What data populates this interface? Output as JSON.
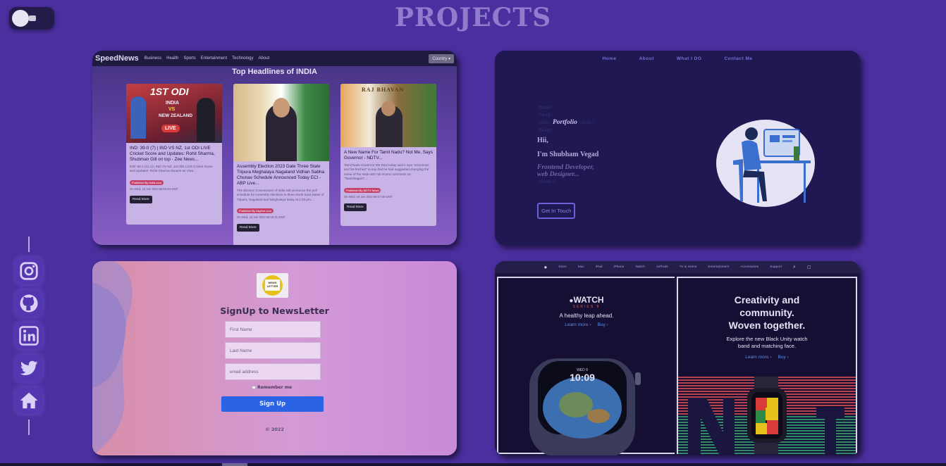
{
  "page": {
    "title": "PROJECTS"
  },
  "theme_toggle": {
    "icon": "bulb-icon"
  },
  "social": {
    "items": [
      "instagram-icon",
      "github-icon",
      "linkedin-icon",
      "twitter-icon",
      "home-icon"
    ]
  },
  "news": {
    "brand": "SpeedNews",
    "nav": [
      "Business",
      "Health",
      "Sports",
      "Entertainment",
      "Technology",
      "About"
    ],
    "country": "Country ▾",
    "heading": "Top Headlines of INDIA",
    "articles": [
      {
        "img_text_1": "1ST ODI",
        "img_text_2": "INDIA",
        "img_text_3": "VS",
        "img_text_4": "NEW ZEALAND",
        "live": "LIVE",
        "title": "IND: 39-0 (7) | IND VS NZ, 1st ODI LIVE Cricket Score and Updates: Rohit Sharma, Shubman Gill on top - Zee News...",
        "desc": "IND: 60-1 (12.1) | IND VS NZ, 1st ODI LIVE Cricket Score and Updates: Rohit Sharma departs as Virat...",
        "pub": "Published By India.com",
        "date": "On Wed, 18 Jan 2023 08:53:54 GMT",
        "btn": "Read More"
      },
      {
        "title": "Assembly Election 2023 Date Three State Tripura Meghalaya Nagaland Vidhan Sabha Chunav Schedule Announced Today ECI - ABP Live...",
        "desc": "The Election Commission of India will announce the poll schedule for Assembly elections in three North East states of Tripura, Nagaland and Meghalaya today at 2:30 pm....",
        "pub": "Published By Abplive.com",
        "date": "On Wed, 18 Jan 2023 08:18:21 GMT",
        "btn": "Read More"
      },
      {
        "img_text_1": "RAJ BHAVAN",
        "title": "A New Name For Tamil Nadu? Not Me, Says Governor - NDTV...",
        "desc": "Tamil Nadu Governor RN Ravi today said it was \"erroneous and far-fetched\" to say that he had suggested changing the name of the state with his recent comments on \"Tamizhagam\"...",
        "pub": "Published By NDTV News",
        "date": "On Wed, 18 Jan 2023 08:17:00 GMT",
        "btn": "Read More"
      }
    ]
  },
  "portfolio": {
    "nav": [
      "Home",
      "About",
      "What I DO",
      "Contact Me"
    ],
    "lines": [
      "<html>",
      "<head>",
      "<title>",
      "Portfolio",
      "</title>",
      "<body>"
    ],
    "greet": "Hii,",
    "name": "I'm Shubham Vegad",
    "role1": "Frontend Developer,",
    "role2": "web Designer...",
    "close": "</body>",
    "cta": "Get In Touch"
  },
  "signup": {
    "logo_line1": "NEWS",
    "logo_line2": "LETTER",
    "title": "SignUp to NewsLetter",
    "first": "First Name",
    "last": "Last Name",
    "email": "email address",
    "remember": "Remember me",
    "button": "Sign Up",
    "footer": "© 2022"
  },
  "apple": {
    "nav": [
      "Store",
      "Mac",
      "iPad",
      "iPhone",
      "Watch",
      "AirPods",
      "TV & Home",
      "Entertainment",
      "Accessories",
      "Support"
    ],
    "watch": {
      "title": "WATCH",
      "series": "SERIES 8",
      "tagline": "A healthy leap ahead.",
      "learn": "Learn more ›",
      "buy": "Buy ›",
      "time": "10:09",
      "day": "WED 9"
    },
    "unity": {
      "h1": "Creativity and",
      "h2": "community.",
      "h3": "Woven together.",
      "p1": "Explore the new Black Unity watch",
      "p2": "band and matching face.",
      "learn": "Learn more ›",
      "buy": "Buy ›"
    }
  }
}
